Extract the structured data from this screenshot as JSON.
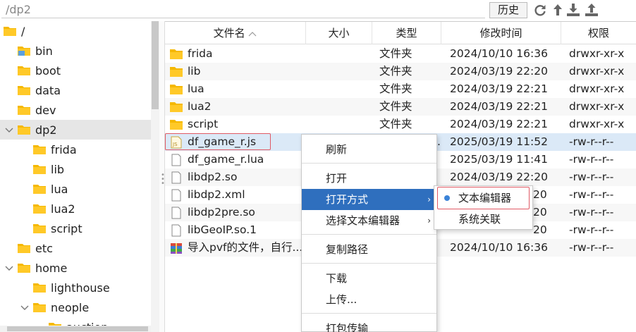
{
  "toolbar": {
    "path": "/dp2",
    "history_label": "历史",
    "icons": [
      "refresh-icon",
      "up-arrow-icon",
      "download-icon",
      "upload-icon"
    ]
  },
  "tree": {
    "root": "/",
    "items": [
      {
        "label": "bin"
      },
      {
        "label": "boot"
      },
      {
        "label": "data"
      },
      {
        "label": "dev"
      },
      {
        "label": "dp2"
      },
      {
        "label": "frida"
      },
      {
        "label": "lib"
      },
      {
        "label": "lua"
      },
      {
        "label": "lua2"
      },
      {
        "label": "script"
      },
      {
        "label": "etc"
      },
      {
        "label": "home"
      },
      {
        "label": "lighthouse"
      },
      {
        "label": "neople"
      },
      {
        "label": "auction"
      }
    ]
  },
  "table": {
    "headers": {
      "name": "文件名",
      "size": "大小",
      "type": "类型",
      "mtime": "修改时间",
      "perm": "权限"
    },
    "rows": [
      {
        "name": "frida",
        "type": "文件夹",
        "mtime": "2024/10/10 16:36",
        "perm": "drwxr-xr-x",
        "icon": "folder-icon"
      },
      {
        "name": "lib",
        "type": "文件夹",
        "mtime": "2024/03/19 22:20",
        "perm": "drwxr-xr-x",
        "icon": "folder-icon"
      },
      {
        "name": "lua",
        "type": "文件夹",
        "mtime": "2024/03/19 22:21",
        "perm": "drwxr-xr-x",
        "icon": "folder-icon"
      },
      {
        "name": "lua2",
        "type": "文件夹",
        "mtime": "2024/03/19 22:21",
        "perm": "drwxr-xr-x",
        "icon": "folder-icon"
      },
      {
        "name": "script",
        "type": "文件夹",
        "mtime": "2024/03/19 22:21",
        "perm": "drwxr-xr-x",
        "icon": "folder-icon"
      },
      {
        "name": "df_game_r.js",
        "type": ".",
        "mtime": "2025/03/19 11:52",
        "perm": "-rw-r--r--",
        "icon": "js-file-icon"
      },
      {
        "name": "df_game_r.lua",
        "type": "",
        "mtime": "2025/03/19 11:41",
        "perm": "-rw-r--r--",
        "icon": "file-icon"
      },
      {
        "name": "libdp2.so",
        "type": "",
        "mtime": "2024/03/19 22:20",
        "perm": "-rw-r--r--",
        "icon": "file-icon"
      },
      {
        "name": "libdp2.xml",
        "type": "",
        "mtime": "20",
        "perm": "-rw-r--r--",
        "icon": "file-icon"
      },
      {
        "name": "libdp2pre.so",
        "type": "",
        "mtime": "20",
        "perm": "-rw-r--r--",
        "icon": "file-icon"
      },
      {
        "name": "libGeoIP.so.1",
        "type": "",
        "mtime": "20",
        "perm": "-rw-r--r--",
        "icon": "file-icon"
      },
      {
        "name": "导入pvf的文件，自行...",
        "type": "",
        "mtime": "2024/10/10 16:36",
        "perm": "-rw-r--r--",
        "icon": "archive-icon"
      }
    ]
  },
  "context_menu": {
    "items": [
      "刷新",
      "打开",
      "打开方式",
      "选择文本编辑器",
      "复制路径",
      "下载",
      "上传...",
      "打包传输"
    ],
    "arrow": "›"
  },
  "submenu": {
    "items": [
      "文本编辑器",
      "系统关联"
    ]
  },
  "colors": {
    "folder": "#f5b800",
    "menu_highlight": "#2f6fbe",
    "callout": "#e05a65",
    "row_highlight": "#dbe9f7"
  }
}
